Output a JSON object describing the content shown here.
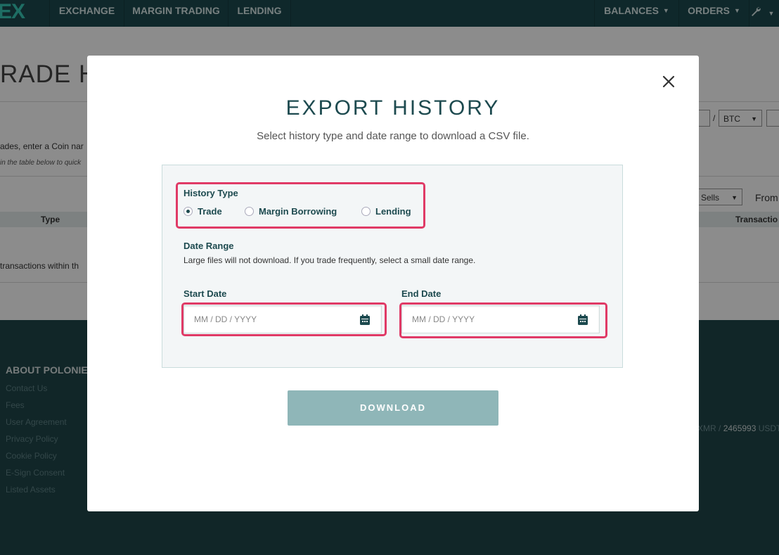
{
  "nav": {
    "logo": "EX",
    "items": [
      "EXCHANGE",
      "MARGIN TRADING",
      "LENDING"
    ],
    "right": [
      "BALANCES",
      "ORDERS"
    ]
  },
  "background": {
    "title": "RADE HI",
    "coin_hint": "ades, enter a Coin nar",
    "table_hint": "in the table below to quick",
    "pair_select": "BTC",
    "slash": "/",
    "sells_select": "Sells",
    "from_label": "From",
    "col_type": "Type",
    "col_transaction": "Transactio",
    "empty_msg": "transactions within th"
  },
  "footer": {
    "heading": "ABOUT POLONIEX",
    "links": [
      "Contact Us",
      "Fees",
      "User Agreement",
      "Privacy Policy",
      "Cookie Policy",
      "E-Sign Consent",
      "Listed Assets"
    ],
    "stat_prefix": "XMR /",
    "stat_value": "2465993",
    "stat_suffix": "USDT"
  },
  "modal": {
    "title": "EXPORT HISTORY",
    "subtitle": "Select history type and date range to download a CSV file.",
    "history_type_label": "History Type",
    "options": [
      "Trade",
      "Margin Borrowing",
      "Lending"
    ],
    "selected_option": "Trade",
    "date_range_label": "Date Range",
    "date_range_hint": "Large files will not download. If you trade frequently, select a small date range.",
    "start_date_label": "Start Date",
    "end_date_label": "End Date",
    "date_placeholder": "MM / DD / YYYY",
    "download_label": "DOWNLOAD"
  },
  "colors": {
    "nav": "#1d4a4f",
    "accent_text": "#1d4a4f",
    "highlight": "#e03a66",
    "download_button": "#8fb6b8"
  }
}
